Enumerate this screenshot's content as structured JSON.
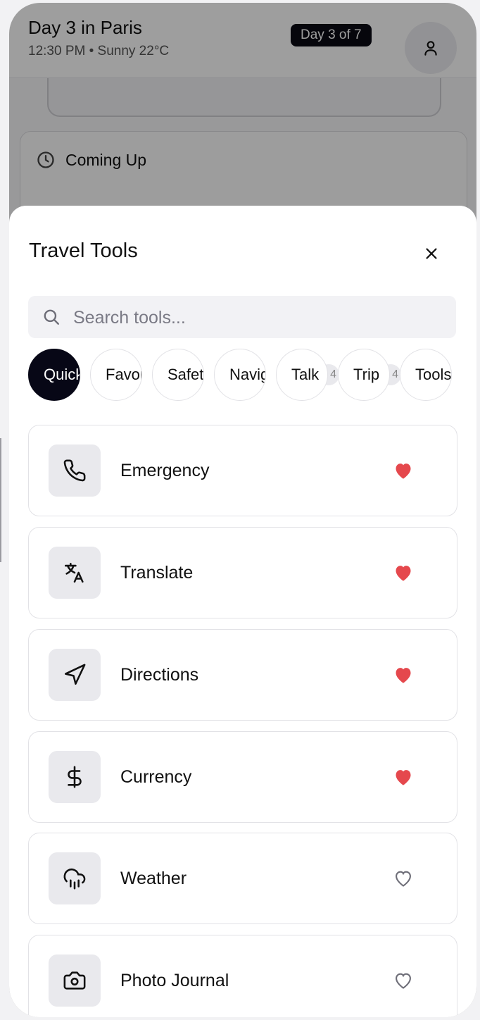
{
  "header": {
    "title": "Day 3 in Paris",
    "subtitle": "12:30 PM • Sunny 22°C",
    "day_badge": "Day 3 of 7"
  },
  "background_card": {
    "title": "Coming Up"
  },
  "sheet": {
    "title": "Travel Tools",
    "search_placeholder": "Search tools...",
    "chips": [
      {
        "label": "Quick",
        "active": true
      },
      {
        "label": "Favorites"
      },
      {
        "label": "Safety"
      },
      {
        "label": "Navigation"
      },
      {
        "label": "Talk",
        "count": "4"
      },
      {
        "label": "Trip",
        "count": "4"
      },
      {
        "label": "Tools"
      }
    ],
    "tools": [
      {
        "label": "Emergency",
        "icon": "phone-icon",
        "favorite": true
      },
      {
        "label": "Translate",
        "icon": "translate-icon",
        "favorite": true
      },
      {
        "label": "Directions",
        "icon": "navigation-arrow-icon",
        "favorite": true
      },
      {
        "label": "Currency",
        "icon": "dollar-icon",
        "favorite": true
      },
      {
        "label": "Weather",
        "icon": "cloud-rain-icon",
        "favorite": false
      },
      {
        "label": "Photo Journal",
        "icon": "camera-icon",
        "favorite": false
      }
    ]
  },
  "colors": {
    "accent_dark": "#070716",
    "favorite_red": "#e5484d",
    "muted": "#6e6e78"
  }
}
